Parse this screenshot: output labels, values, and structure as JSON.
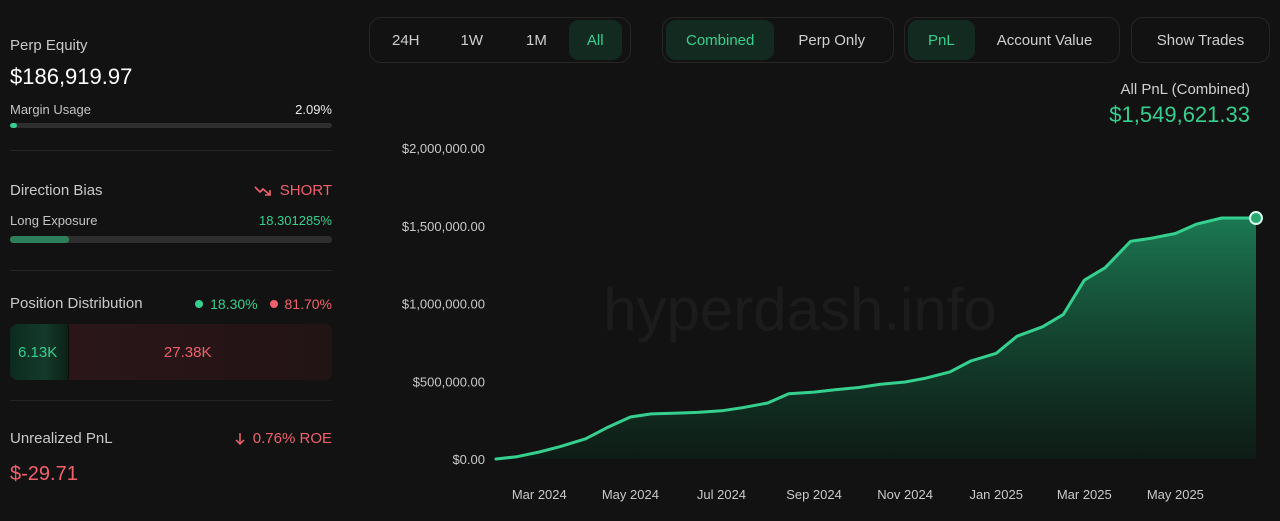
{
  "equity": {
    "label": "Perp Equity",
    "value": "$186,919.97"
  },
  "margin": {
    "label": "Margin Usage",
    "value": "2.09%",
    "fraction": 0.0209
  },
  "bias": {
    "label": "Direction Bias",
    "value": "SHORT",
    "icon": "trend-down-icon"
  },
  "long_exposure": {
    "label": "Long Exposure",
    "value": "18.301285%",
    "fraction": 0.18301285
  },
  "distribution": {
    "label": "Position Distribution",
    "long_pct": "18.30%",
    "short_pct": "81.70%",
    "long_value": "6.13K",
    "short_value": "27.38K",
    "long_fraction": 0.183
  },
  "unrealized": {
    "label": "Unrealized PnL",
    "roe": "0.76% ROE",
    "roe_icon": "arrow-down-icon",
    "value": "$-29.71"
  },
  "toolbar": {
    "ranges": [
      "24H",
      "1W",
      "1M",
      "All"
    ],
    "active_range": "All",
    "scopes": [
      "Combined",
      "Perp Only"
    ],
    "active_scope": "Combined",
    "metrics": [
      "PnL",
      "Account Value"
    ],
    "active_metric": "PnL",
    "show_trades": "Show Trades"
  },
  "colors": {
    "accent_green": "#35d08f",
    "red": "#f0616d",
    "background": "#121212"
  },
  "watermark": "hyperdash.info",
  "chart_data": {
    "type": "area",
    "title": "All PnL (Combined)",
    "total_label": "$1,549,621.33",
    "xlabel": "",
    "ylabel": "",
    "ylim": [
      0,
      2000000
    ],
    "y_ticks": [
      0,
      500000,
      1000000,
      1500000,
      2000000
    ],
    "y_tick_labels": [
      "$0.00",
      "$500,000.00",
      "$1,000,000.00",
      "$1,500,000.00",
      "$2,000,000.00"
    ],
    "x_range": [
      "2024-02-01",
      "2025-06-24"
    ],
    "x_ticks": [
      "2024-03-01",
      "2024-05-01",
      "2024-07-01",
      "2024-09-01",
      "2024-11-01",
      "2025-01-01",
      "2025-03-01",
      "2025-05-01"
    ],
    "x_tick_labels": [
      "Mar 2024",
      "May 2024",
      "Jul 2024",
      "Sep 2024",
      "Nov 2024",
      "Jan 2025",
      "Mar 2025",
      "May 2025"
    ],
    "grid": false,
    "series": [
      {
        "points": [
          [
            "2024-02-01",
            0
          ],
          [
            "2024-02-15",
            15000
          ],
          [
            "2024-03-01",
            45000
          ],
          [
            "2024-03-15",
            80000
          ],
          [
            "2024-04-01",
            130000
          ],
          [
            "2024-04-15",
            200000
          ],
          [
            "2024-05-01",
            270000
          ],
          [
            "2024-05-15",
            290000
          ],
          [
            "2024-06-01",
            295000
          ],
          [
            "2024-06-15",
            300000
          ],
          [
            "2024-07-01",
            310000
          ],
          [
            "2024-07-15",
            330000
          ],
          [
            "2024-08-01",
            360000
          ],
          [
            "2024-08-15",
            420000
          ],
          [
            "2024-09-01",
            430000
          ],
          [
            "2024-09-15",
            445000
          ],
          [
            "2024-10-01",
            460000
          ],
          [
            "2024-10-15",
            480000
          ],
          [
            "2024-11-01",
            495000
          ],
          [
            "2024-11-15",
            520000
          ],
          [
            "2024-12-01",
            560000
          ],
          [
            "2024-12-15",
            630000
          ],
          [
            "2025-01-01",
            680000
          ],
          [
            "2025-01-15",
            790000
          ],
          [
            "2025-02-01",
            850000
          ],
          [
            "2025-02-15",
            930000
          ],
          [
            "2025-03-01",
            1150000
          ],
          [
            "2025-03-15",
            1230000
          ],
          [
            "2025-04-01",
            1400000
          ],
          [
            "2025-04-15",
            1420000
          ],
          [
            "2025-05-01",
            1450000
          ],
          [
            "2025-05-15",
            1510000
          ],
          [
            "2025-06-01",
            1550000
          ],
          [
            "2025-06-24",
            1549621
          ]
        ]
      }
    ]
  }
}
